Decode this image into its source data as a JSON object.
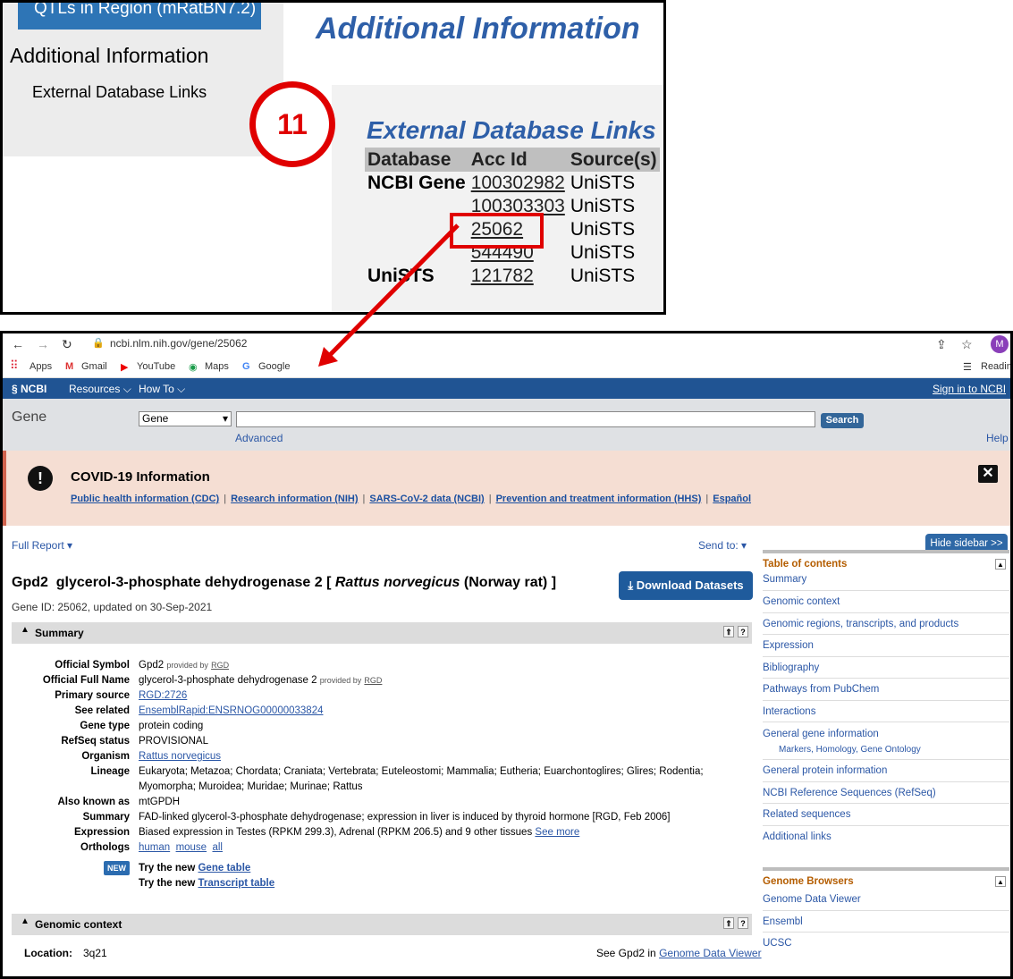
{
  "top": {
    "qtl_button": "QTLs in Region (mRatBN7.2)",
    "nav_heading": "Additional Information",
    "nav_link": "External Database Links",
    "main_heading": "Additional Information",
    "step_number": "11",
    "ext_heading": "External Database Links",
    "table_headers": [
      "Database",
      "Acc Id",
      "Source(s)"
    ],
    "rows": [
      {
        "db": "NCBI Gene",
        "acc": "100302982",
        "src": "UniSTS"
      },
      {
        "db": "",
        "acc": "100303303",
        "src": "UniSTS"
      },
      {
        "db": "",
        "acc": "25062",
        "src": "UniSTS"
      },
      {
        "db": "",
        "acc": "544490",
        "src": "UniSTS"
      },
      {
        "db": "UniSTS",
        "acc": "121782",
        "src": "UniSTS"
      }
    ]
  },
  "browser": {
    "url": "ncbi.nlm.nih.gov/gene/25062",
    "avatar": "M",
    "bookmarks": [
      "Apps",
      "Gmail",
      "YouTube",
      "Maps",
      "Google"
    ],
    "reading": "Readin",
    "ncbi": {
      "logo": "NCBI",
      "resources": "Resources",
      "howto": "How To",
      "signin": "Sign in to NCBI"
    },
    "search": {
      "db_label": "Gene",
      "db_select": "Gene",
      "button": "Search",
      "advanced": "Advanced",
      "help": "Help"
    },
    "covid": {
      "title": "COVID-19 Information",
      "links": [
        "Public health information (CDC)",
        "Research information (NIH)",
        "SARS-CoV-2 data (NCBI)",
        "Prevention and treatment information (HHS)",
        "Español"
      ]
    },
    "report": {
      "full_report": "Full Report",
      "send_to": "Send to:",
      "hide_sidebar": "Hide sidebar >>",
      "gene_symbol": "Gpd2",
      "gene_name": "glycerol-3-phosphate dehydrogenase 2 [",
      "species": "Rattus norvegicus",
      "common": "(Norway rat) ]",
      "gene_id_line": "Gene ID: 25062, updated on 30-Sep-2021",
      "download": "Download Datasets",
      "summary_title": "Summary",
      "fields": [
        {
          "k": "Official Symbol",
          "v": "Gpd2",
          "prov": "provided by",
          "link": "RGD"
        },
        {
          "k": "Official Full Name",
          "v": "glycerol-3-phosphate dehydrogenase 2",
          "prov": "provided by",
          "link": "RGD"
        },
        {
          "k": "Primary source",
          "v": "",
          "link": "RGD:2726"
        },
        {
          "k": "See related",
          "v": "",
          "link": "EnsemblRapid:ENSRNOG00000033824"
        },
        {
          "k": "Gene type",
          "v": "protein coding"
        },
        {
          "k": "RefSeq status",
          "v": "PROVISIONAL"
        },
        {
          "k": "Organism",
          "v": "",
          "link": "Rattus norvegicus"
        },
        {
          "k": "Lineage",
          "v": "Eukaryota; Metazoa; Chordata; Craniata; Vertebrata; Euteleostomi; Mammalia; Eutheria; Euarchontoglires; Glires; Rodentia; Myomorpha; Muroidea; Muridae; Murinae; Rattus"
        },
        {
          "k": "Also known as",
          "v": "mtGPDH"
        },
        {
          "k": "Summary",
          "v": "FAD-linked glycerol-3-phosphate dehydrogenase; expression in liver is induced by thyroid hormone [RGD, Feb 2006]"
        },
        {
          "k": "Expression",
          "v": "Biased expression in Testes (RPKM 299.3), Adrenal (RPKM 206.5) and 9 other tissues",
          "link": "See more"
        },
        {
          "k": "Orthologs",
          "v": "",
          "links": [
            "human",
            "mouse",
            "all"
          ]
        }
      ],
      "new_badge": "NEW",
      "try_gene": "Try the new",
      "gene_table": "Gene table",
      "transcript_table": "Transcript table",
      "genomic_title": "Genomic context",
      "location_label": "Location:",
      "location_value": "3q21",
      "see_in": "See Gpd2 in",
      "genome_viewer": "Genome Data Viewer"
    },
    "sidebar": {
      "toc_title": "Table of contents",
      "toc": [
        "Summary",
        "Genomic context",
        "Genomic regions, transcripts, and products",
        "Expression",
        "Bibliography",
        "Pathways from PubChem",
        "Interactions",
        "General gene information",
        "General protein information",
        "NCBI Reference Sequences (RefSeq)",
        "Related sequences",
        "Additional links"
      ],
      "gene_info_sub": "Markers,  Homology,  Gene Ontology",
      "gb_title": "Genome Browsers",
      "gb": [
        "Genome Data Viewer",
        "Ensembl",
        "UCSC"
      ]
    }
  }
}
